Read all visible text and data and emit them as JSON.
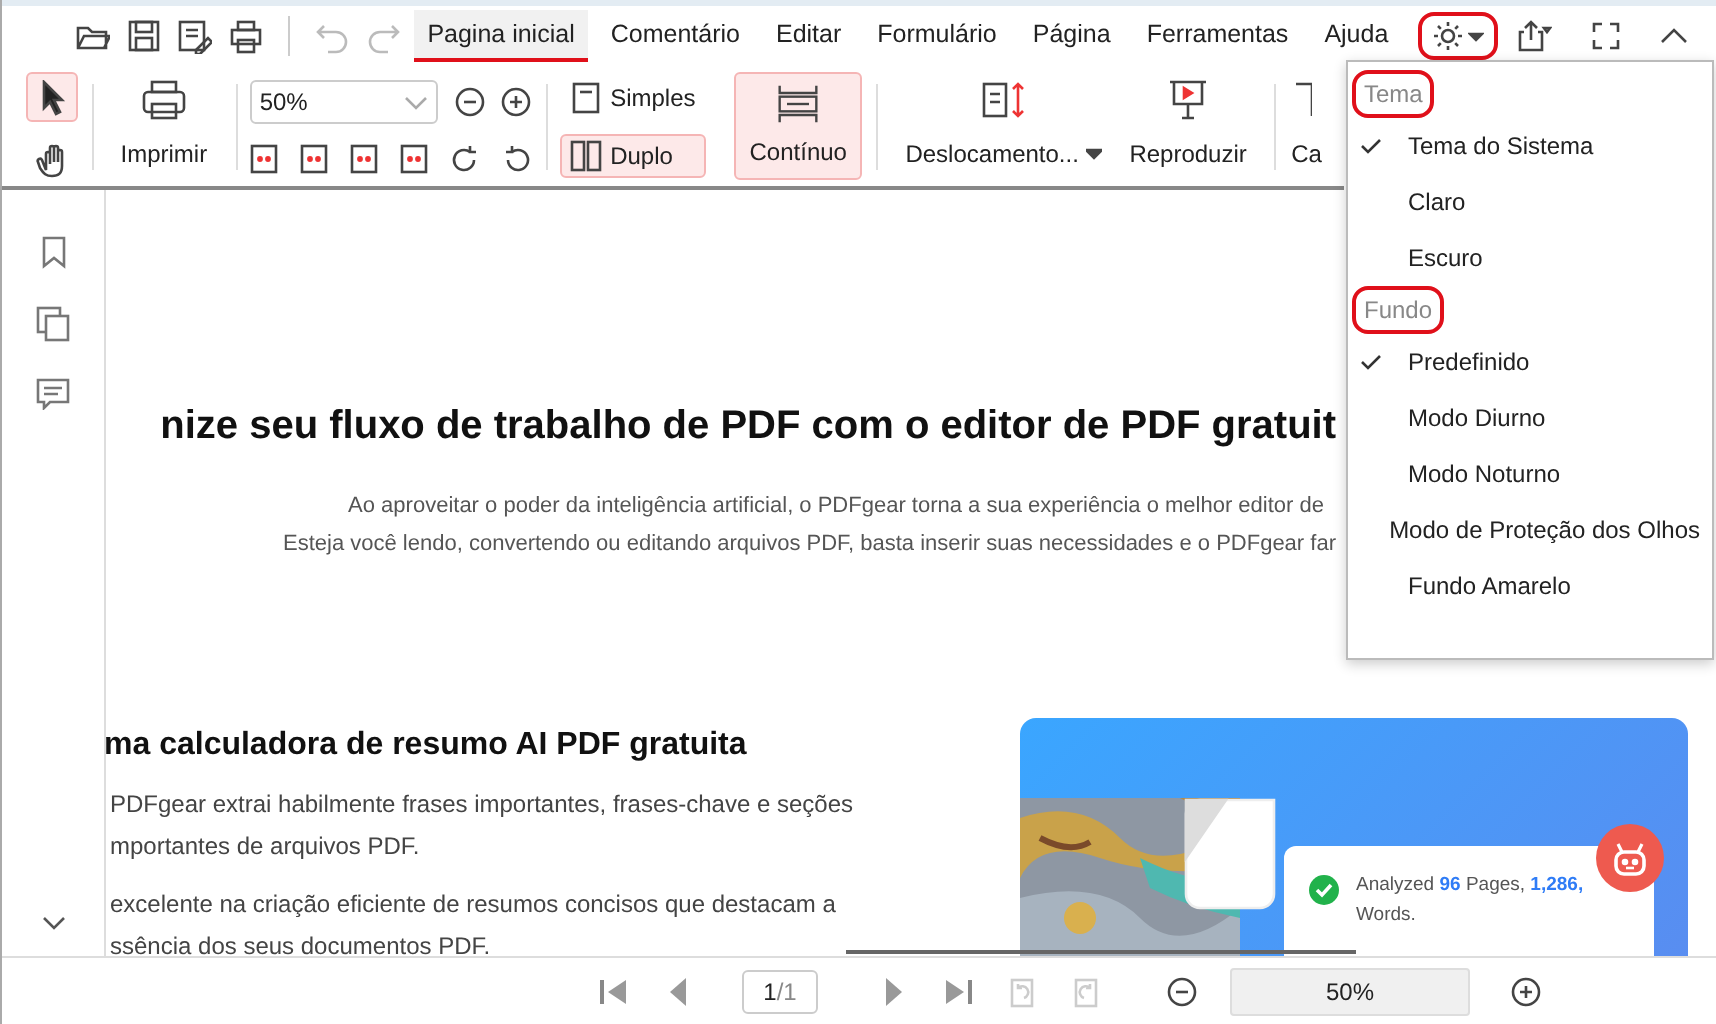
{
  "quick_access": [
    {
      "kind": "open",
      "disabled": false
    },
    {
      "kind": "save",
      "disabled": false
    },
    {
      "kind": "save-as",
      "disabled": false
    },
    {
      "kind": "print",
      "disabled": false
    },
    {
      "kind": "undo",
      "disabled": true
    },
    {
      "kind": "redo",
      "disabled": true
    }
  ],
  "tabs": [
    {
      "label": "Pagina inicial",
      "selected": true
    },
    {
      "label": "Comentário",
      "selected": false
    },
    {
      "label": "Editar",
      "selected": false
    },
    {
      "label": "Formulário",
      "selected": false
    },
    {
      "label": "Página",
      "selected": false
    },
    {
      "label": "Ferramentas",
      "selected": false
    },
    {
      "label": "Ajuda",
      "selected": false
    }
  ],
  "theme_button": {
    "highlighted": true
  },
  "ribbon": {
    "tools": [
      {
        "kind": "select",
        "selected": true
      },
      {
        "kind": "hand",
        "selected": false
      }
    ],
    "print_label": "Imprimir",
    "zoom_value": "50%",
    "view_modes": [
      {
        "label": "Simples",
        "kind": "simples",
        "selected": false
      },
      {
        "label": "Duplo",
        "kind": "duplo",
        "selected": true
      },
      {
        "label": "Contínuo",
        "kind": "continuo",
        "selected": true
      }
    ],
    "scroll_label": "Deslocamento...",
    "play_label": "Reproduzir",
    "cut_label": "Ca"
  },
  "theme_menu": [
    {
      "title": "Tema",
      "highlighted": true,
      "items": [
        {
          "label": "Tema do Sistema",
          "checked": true
        },
        {
          "label": "Claro",
          "checked": false
        },
        {
          "label": "Escuro",
          "checked": false
        }
      ]
    },
    {
      "title": "Fundo",
      "highlighted": true,
      "items": [
        {
          "label": "Predefinido",
          "checked": true
        },
        {
          "label": "Modo Diurno",
          "checked": false
        },
        {
          "label": "Modo Noturno",
          "checked": false
        },
        {
          "label": "Modo de Proteção dos Olhos",
          "checked": false
        },
        {
          "label": "Fundo Amarelo",
          "checked": false
        }
      ]
    }
  ],
  "document": {
    "heading": "nize seu fluxo de trabalho de PDF com o editor de PDF gratuit",
    "intro_lines": [
      "Ao aproveitar o poder da inteligência artificial, o PDFgear torna a sua experiência o melhor editor de",
      "Esteja você lendo, convertendo ou editando arquivos PDF, basta inserir suas necessidades e o PDFgear far"
    ],
    "section_heading": "ma calculadora de resumo AI PDF gratuita",
    "paragraphs": [
      [
        "PDFgear extrai habilmente frases importantes, frases-chave e seções",
        "mportantes de arquivos PDF."
      ],
      [
        "excelente na criação eficiente de resumos concisos que destacam a",
        "ssência dos seus documentos PDF."
      ]
    ],
    "card_text": "Analyzed **96** Pages, **1,286,**",
    "card_text_2": "Words."
  },
  "bottom_bar": {
    "page": "1",
    "page_total": "/1",
    "zoom": "50%"
  }
}
